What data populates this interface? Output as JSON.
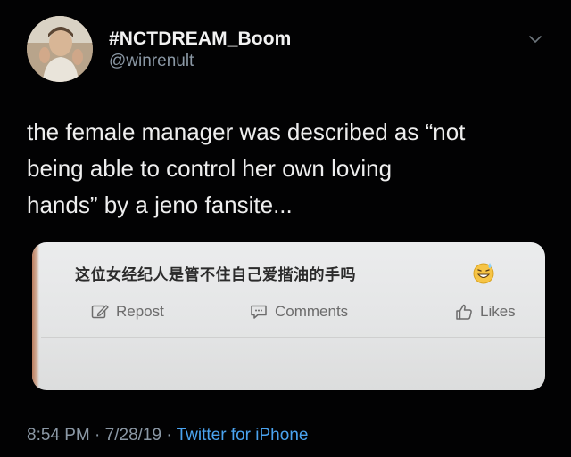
{
  "tweet": {
    "display_name": "#NCTDREAM_Boom",
    "handle": "@winrenult",
    "text": "the female manager was described as “not\nbeing able to control her own loving\nhands” by a jeno fansite...",
    "embedded_post": {
      "caption": "这位女经纪人是管不住自己爱揩油的手吗",
      "emoji_icon": "grinning-sweat-emoji-icon",
      "actions": {
        "repost": "Repost",
        "comments": "Comments",
        "likes": "Likes"
      }
    },
    "meta": {
      "time": "8:54 PM",
      "separator": "·",
      "date": "7/28/19",
      "source": "Twitter for iPhone"
    }
  },
  "colors": {
    "background": "#020203",
    "primary_text": "#eeeeee",
    "secondary_text": "#8b98a5",
    "link": "#4aa3ef",
    "card_background": "#e8e9ea"
  },
  "icons": {
    "chevron": "chevron-down-icon",
    "repost": "edit-square-icon",
    "comments": "comment-bubble-icon",
    "likes": "thumbs-up-icon"
  }
}
